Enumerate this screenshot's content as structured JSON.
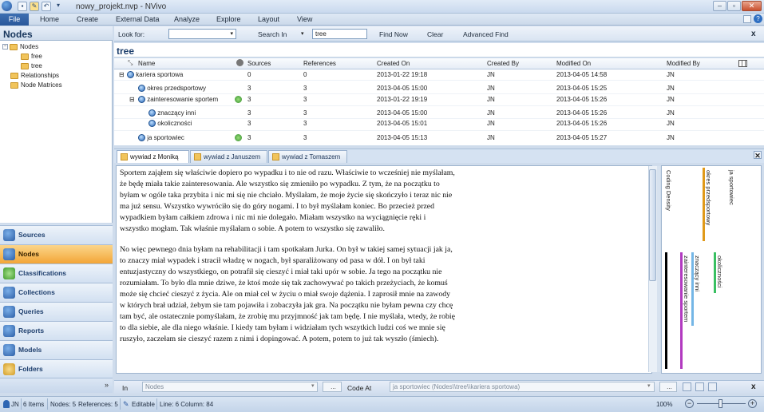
{
  "window": {
    "title": "nowy_projekt.nvp - NVivo"
  },
  "quick_access": [
    "save-icon",
    "edit-icon",
    "undo-icon",
    "redo-icon"
  ],
  "menu": {
    "file": "File",
    "items": [
      "Home",
      "Create",
      "External Data",
      "Analyze",
      "Explore",
      "Layout",
      "View"
    ]
  },
  "nav": {
    "title": "Nodes",
    "tree": [
      {
        "label": "Nodes",
        "level": 0
      },
      {
        "label": "free",
        "level": 1
      },
      {
        "label": "tree",
        "level": 1
      },
      {
        "label": "Relationships",
        "level": 0
      },
      {
        "label": "Node Matrices",
        "level": 0
      }
    ],
    "sections": [
      "Sources",
      "Nodes",
      "Classifications",
      "Collections",
      "Queries",
      "Reports",
      "Models",
      "Folders"
    ],
    "active_section": "Nodes"
  },
  "findbar": {
    "look_for_label": "Look for:",
    "search_in_label": "Search In",
    "search_in_value": "tree",
    "find_now": "Find Now",
    "clear": "Clear",
    "advanced_find": "Advanced Find",
    "close": "x"
  },
  "list": {
    "title": "tree",
    "columns": [
      "Name",
      "Sources",
      "References",
      "Created On",
      "Created By",
      "Modified On",
      "Modified By"
    ],
    "rows": [
      {
        "name": "kariera sportowa",
        "sources": "0",
        "references": "0",
        "created_on": "2013-01-22 19:18",
        "created_by": "JN",
        "modified_on": "2013-04-05 14:58",
        "modified_by": "JN"
      },
      {
        "name": "okres przedsportowy",
        "sources": "3",
        "references": "3",
        "created_on": "2013-04-05 15:00",
        "created_by": "JN",
        "modified_on": "2013-04-05 15:25",
        "modified_by": "JN"
      },
      {
        "name": "zainteresowanie sportem",
        "sources": "3",
        "references": "3",
        "created_on": "2013-01-22 19:19",
        "created_by": "JN",
        "modified_on": "2013-04-05 15:26",
        "modified_by": "JN"
      },
      {
        "name": "znaczący inni",
        "sources": "3",
        "references": "3",
        "created_on": "2013-04-05 15:00",
        "created_by": "JN",
        "modified_on": "2013-04-05 15:26",
        "modified_by": "JN"
      },
      {
        "name": "okoliczności",
        "sources": "3",
        "references": "3",
        "created_on": "2013-04-05 15:01",
        "created_by": "JN",
        "modified_on": "2013-04-05 15:26",
        "modified_by": "JN"
      },
      {
        "name": "ja sportowiec",
        "sources": "3",
        "references": "3",
        "created_on": "2013-04-05 15:13",
        "created_by": "JN",
        "modified_on": "2013-04-05 15:27",
        "modified_by": "JN"
      }
    ]
  },
  "tabs": [
    "wywiad z Moniką",
    "wywiad z Januszem",
    "wywiad z Tomaszem"
  ],
  "document": {
    "paragraphs": [
      "Sportem zająłem się właściwie dopiero po wypadku i to nie od razu. Właściwie to wcześniej nie myślałam, że będę miała takie zainteresowania. Ale wszystko się zmieniło po wypadku. Z tym, że na początku to byłam w ogóle taka przybita i nic mi się nie chciało. Myślałam, że moje życie się skończyło i teraz nic nie ma już sensu. Wszystko wywróciło się do góry nogami. I to był myślałam koniec. Bo przecież przed wypadkiem byłam całkiem zdrowa i nic mi nie dolegało. Miałam wszystko na wyciągnięcie ręki i wszystko mogłam. Tak właśnie myślałam o sobie. A potem to wszystko się zawaliło.",
      "No więc pewnego dnia byłam na rehabilitacji i tam spotkałam Jurka. On był w takiej samej sytuacji jak ja, to znaczy miał wypadek i stracił władzę w nogach, był sparaliżowany od pasa w dół. I on był taki entuzjastyczny do wszystkiego, on potrafił się cieszyć i miał taki upór w sobie. Ja tego na początku nie rozumiałam. To było dla mnie dziwe, że ktoś może się tak zachowywać po takich przeżyciach, że komuś może się chcieć cieszyć z życia. Ale on miał cel w życiu o miał swoje dążenia. I zaprosił mnie na zawody w których brał udział, żebym sie tam pojawiła i zobaczyła jak gra. Na początku nie byłam pewna czy chcę tam być, ale ostatecznie pomyślałam, że zrobię mu przyjmność jak tam będę. I nie myślała, wtedy, że robię to dla siebie, ale dla niego właśnie. I kiedy tam byłam i widziałam tych wszytkich ludzi coś we mnie się ruszyło, zaczełam sie cieszyć razem z nimi i dopingować. A potem, potem to już tak wyszło (śmiech)."
    ]
  },
  "stripes": [
    {
      "label": "Coding Density",
      "color": "#000000"
    },
    {
      "label": "okres przedsportowy",
      "color": "#e09a1a"
    },
    {
      "label": "ja sportowiec",
      "color": "#2c5fb5"
    },
    {
      "label": "zainteresowanie sportem",
      "color": "#b23ac0"
    },
    {
      "label": "znaczący inni",
      "color": "#74b6e6"
    },
    {
      "label": "okoliczności",
      "color": "#39c062"
    }
  ],
  "codebar": {
    "in_label": "In",
    "in_value": "Nodes",
    "code_at_label": "Code At",
    "code_at_value": "ja sportowiec (Nodes\\\\tree\\\\kariera sportowa)",
    "close": "x"
  },
  "status": {
    "user": "JN",
    "items": "6 Items",
    "nodes": "Nodes: 5",
    "references": "References: 5",
    "editable": "Editable",
    "line": "Line: 6 Column: 84",
    "zoom": "100%"
  }
}
